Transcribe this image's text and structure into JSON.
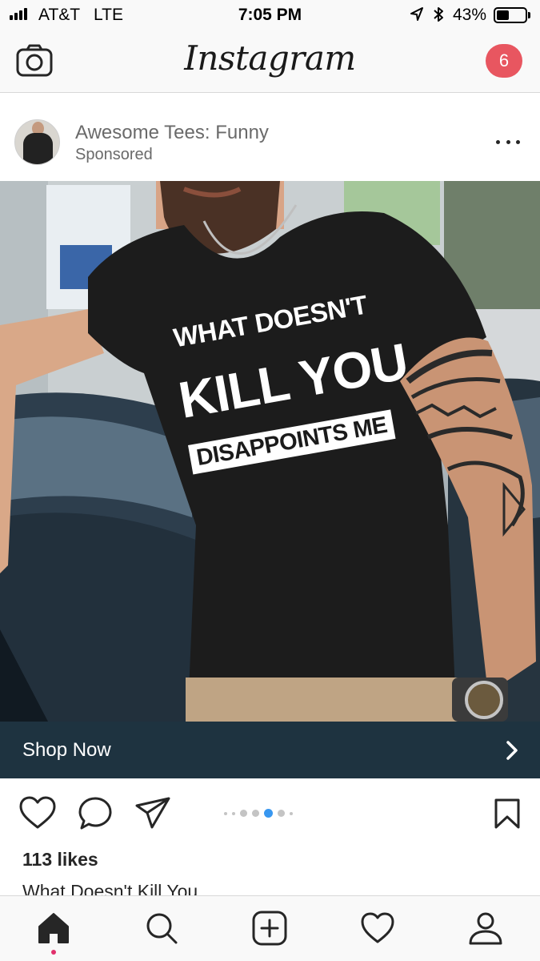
{
  "status_bar": {
    "carrier": "AT&T",
    "network": "LTE",
    "time": "7:05 PM",
    "battery_percent": "43%",
    "battery_level": 0.43,
    "icons": [
      "signal-bars-icon",
      "location-arrow-icon",
      "bluetooth-icon",
      "battery-icon"
    ]
  },
  "header": {
    "logo_text": "Instagram",
    "notification_count": "6",
    "icons": [
      "camera-icon"
    ],
    "badge_color": "#e85660"
  },
  "post": {
    "account_name": "Awesome Tees: Funny",
    "sponsored_label": "Sponsored",
    "image": {
      "shirt_line_1": "WHAT DOESN'T",
      "shirt_line_2": "KILL YOU",
      "shirt_line_3": "DISAPPOINTS ME"
    },
    "cta_label": "Shop Now",
    "cta_color": "#1e3340",
    "carousel": {
      "count": 7,
      "active_index": 4,
      "active_color": "#3897f0"
    },
    "likes": "113 likes",
    "caption": "What Doesn't Kill You"
  },
  "tab_bar": {
    "tabs": [
      "home-icon",
      "search-icon",
      "new-post-icon",
      "activity-heart-icon",
      "profile-icon"
    ],
    "active_tab": "home-icon"
  }
}
